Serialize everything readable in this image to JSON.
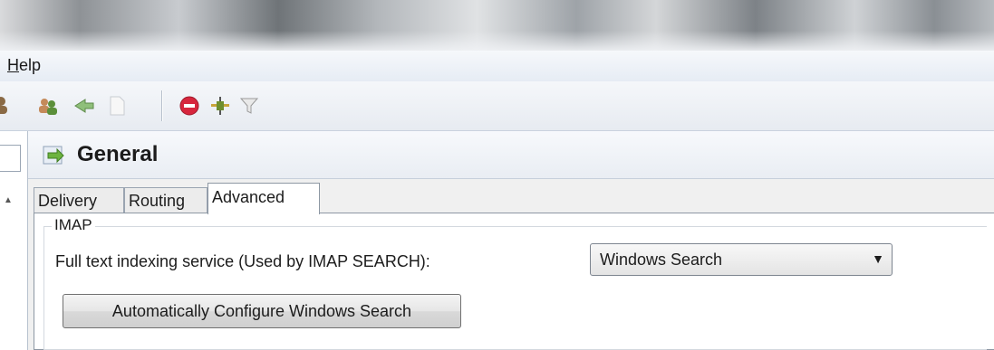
{
  "menu": {
    "items": [
      {
        "label_underlined": "H",
        "label_rest": "elp"
      }
    ]
  },
  "toolbar": {
    "icons": [
      "users-icon",
      "users-group-icon",
      "forward-arrow-icon",
      "blank-page-icon",
      "stop-icon",
      "plug-icon",
      "filter-icon"
    ]
  },
  "header": {
    "title": "General",
    "icon": "document-arrow-icon"
  },
  "tabs": [
    {
      "label": "Delivery",
      "active": false
    },
    {
      "label": "Routing",
      "active": false
    },
    {
      "label": "Advanced",
      "active": true
    }
  ],
  "imap": {
    "group_title": "IMAP",
    "field_label": "Full text indexing service (Used by IMAP SEARCH):",
    "selected_value": "Windows Search",
    "button_label": "Automatically Configure Windows Search"
  }
}
